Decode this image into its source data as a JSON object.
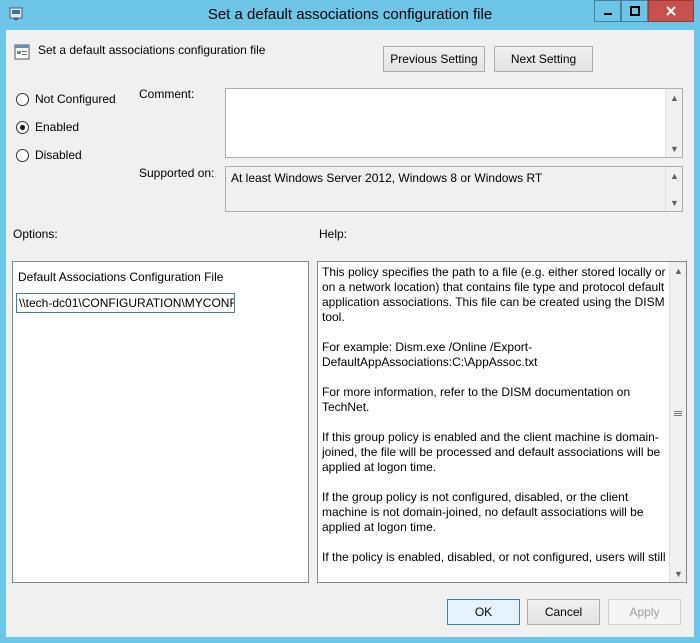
{
  "window": {
    "title": "Set a default associations configuration file"
  },
  "header": {
    "title": "Set a default associations configuration file",
    "previous_label": "Previous Setting",
    "next_label": "Next Setting"
  },
  "state": {
    "not_configured": "Not Configured",
    "enabled": "Enabled",
    "disabled": "Disabled",
    "selected": "enabled"
  },
  "comment": {
    "label": "Comment:",
    "value": ""
  },
  "supported": {
    "label": "Supported on:",
    "value": "At least Windows Server 2012, Windows 8 or Windows RT"
  },
  "options": {
    "label": "Options:",
    "field_label": "Default Associations Configuration File",
    "field_value": "\\\\tech-dc01\\CONFIGURATION\\MYCONF"
  },
  "help": {
    "label": "Help:",
    "paragraphs": [
      "This policy specifies the path to a file (e.g. either stored locally or on a network location) that contains file type and protocol default application associations. This file can be created using the DISM tool.",
      "For example: Dism.exe /Online /Export-DefaultAppAssociations:C:\\AppAssoc.txt",
      "For more information, refer to the DISM documentation on TechNet.",
      "If this group policy is enabled and the client machine is domain-joined, the file will be processed and default associations will be applied at logon time.",
      "If the group policy is not configured, disabled, or the client machine is not domain-joined, no default associations will be applied at logon time.",
      "If the policy is enabled, disabled, or not configured, users will still"
    ]
  },
  "footer": {
    "ok_label": "OK",
    "cancel_label": "Cancel",
    "apply_label": "Apply"
  },
  "colors": {
    "titlebar": "#6cc4e6",
    "close": "#c7504c",
    "client": "#f0f0f0"
  }
}
